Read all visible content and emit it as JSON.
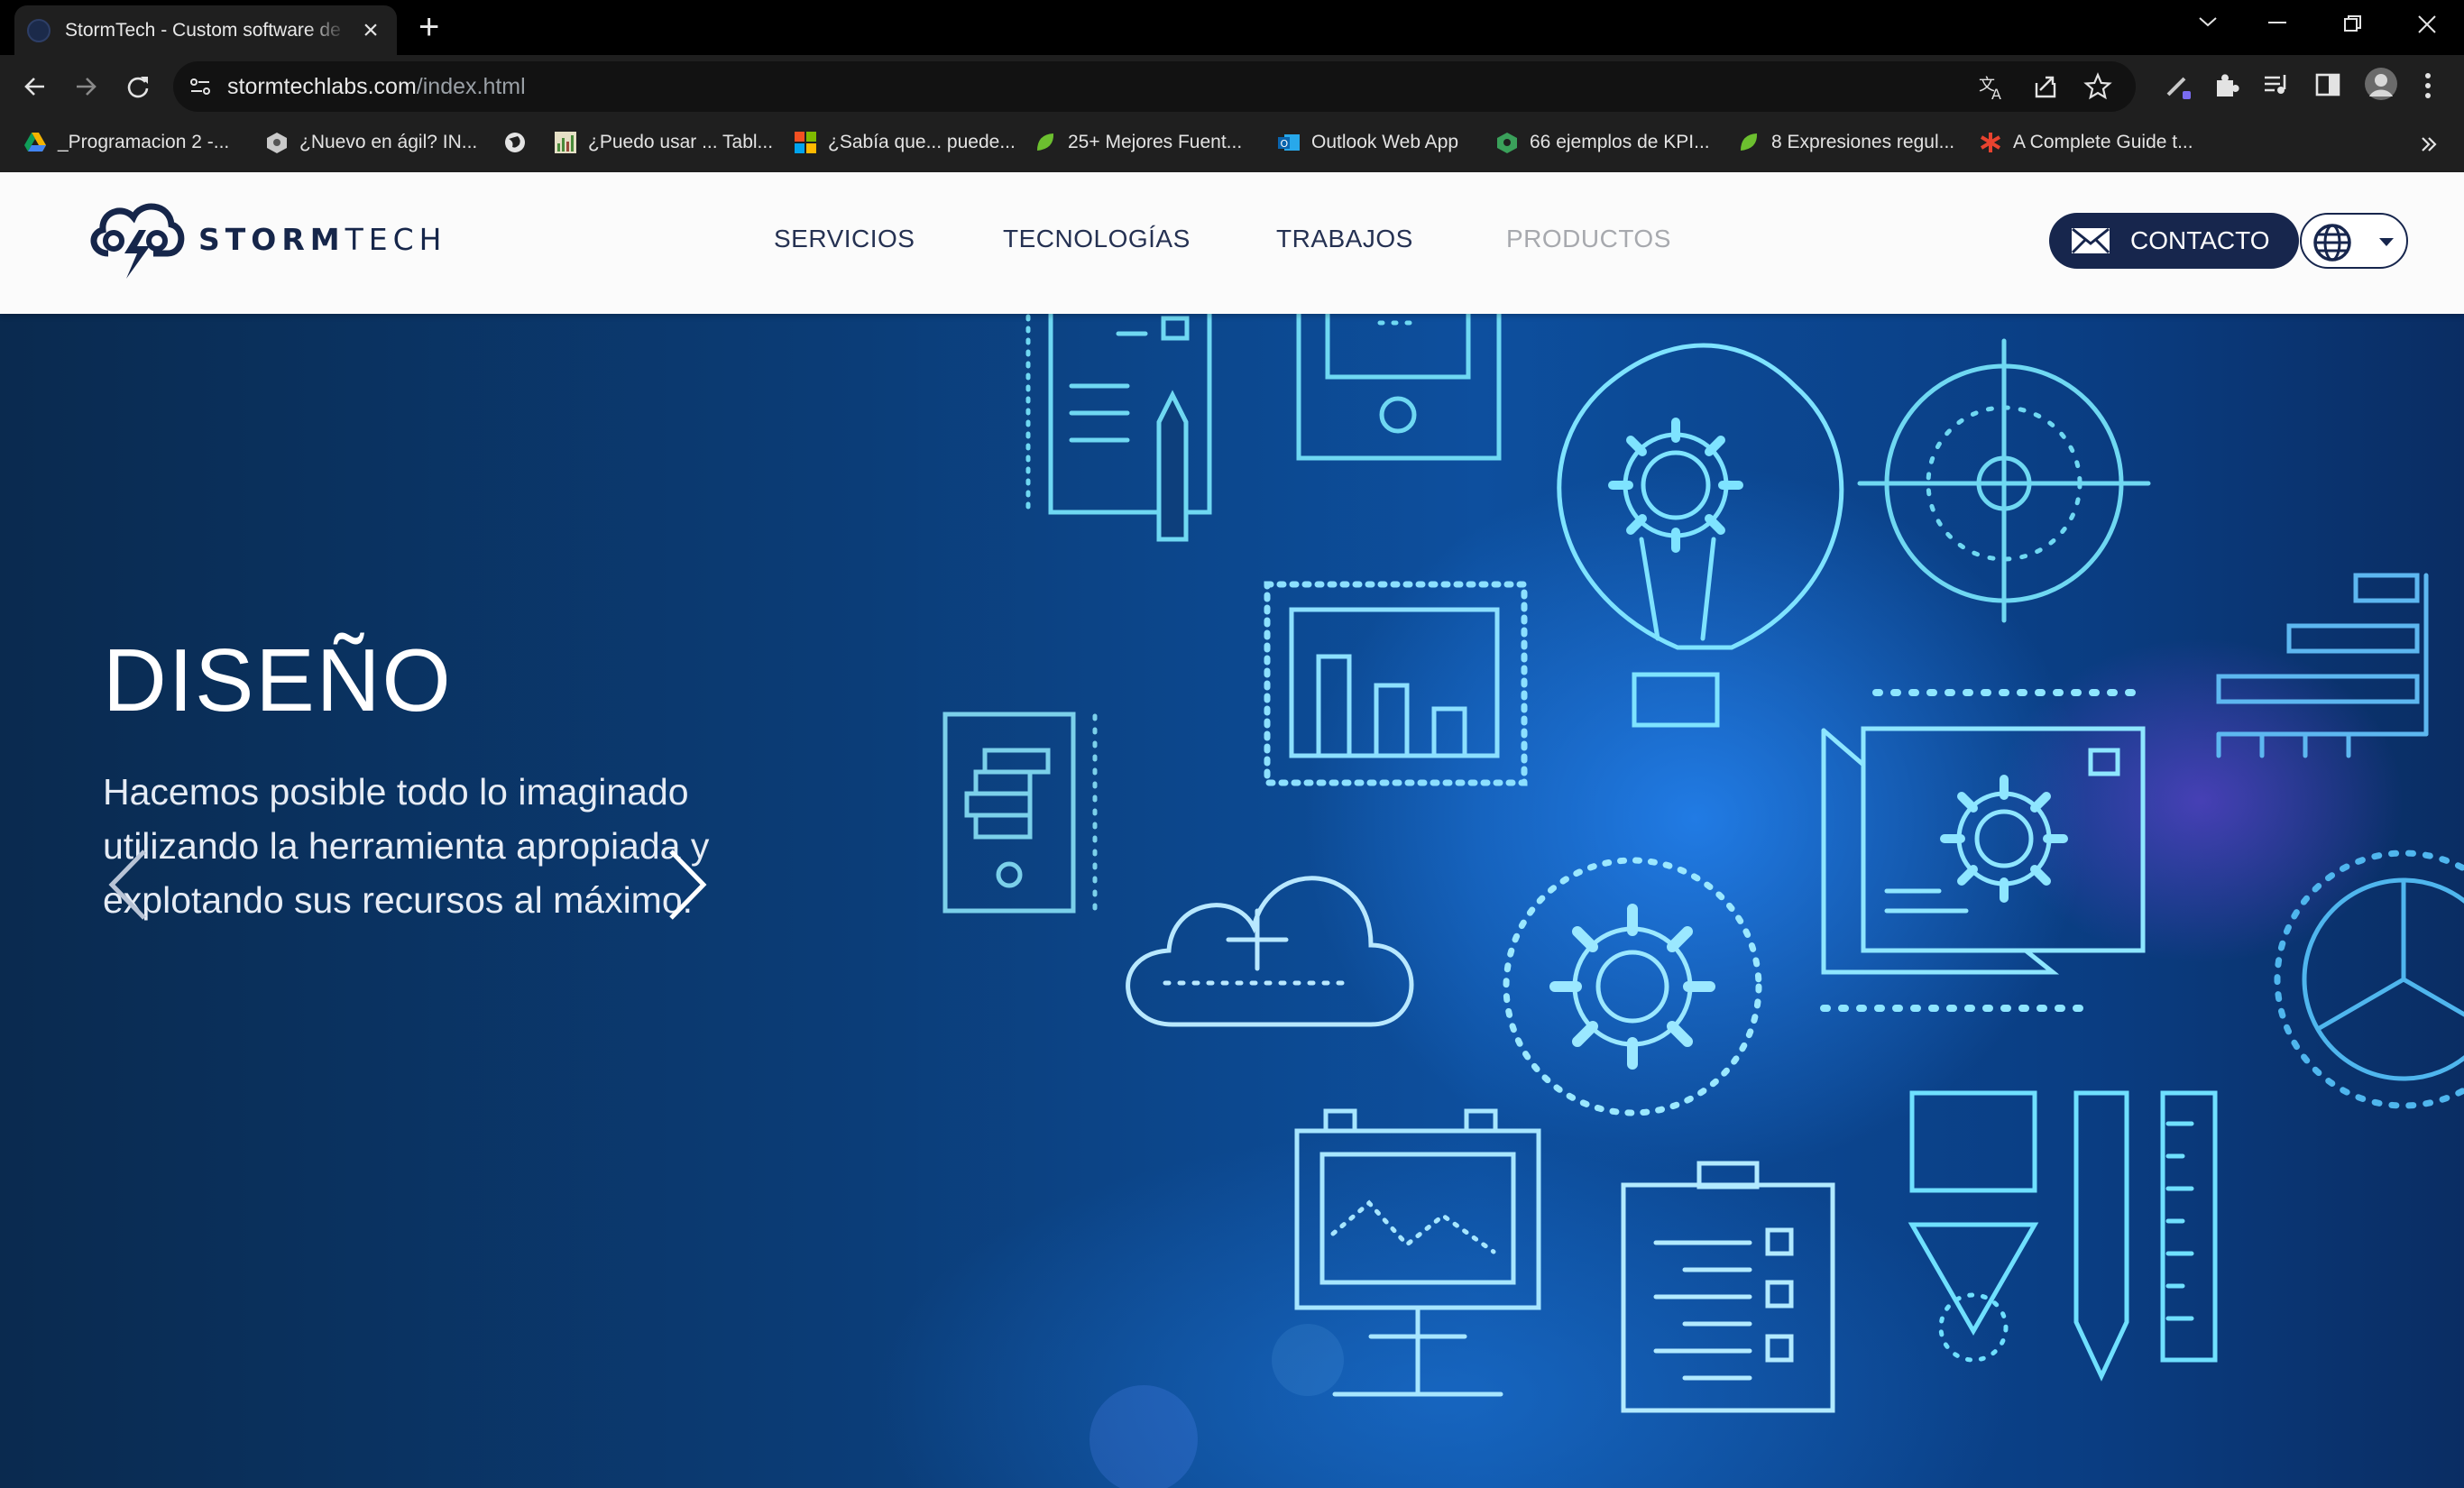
{
  "browser": {
    "tab_title": "StormTech - Custom software de",
    "url_host": "stormtechlabs.com",
    "url_path": "/index.html"
  },
  "bookmarks": [
    {
      "label": "_Programacion 2 -...",
      "icon": "drive-icon"
    },
    {
      "label": "¿Nuevo en ágil? IN...",
      "icon": "site-icon"
    },
    {
      "label": "",
      "icon": "globe-icon"
    },
    {
      "label": "¿Puedo usar ... Tabl...",
      "icon": "site-icon"
    },
    {
      "label": "¿Sabía que... puede...",
      "icon": "microsoft-icon"
    },
    {
      "label": "25+ Mejores Fuent...",
      "icon": "leaf-icon"
    },
    {
      "label": "Outlook Web App",
      "icon": "outlook-icon"
    },
    {
      "label": "66 ejemplos de KPI...",
      "icon": "site-icon"
    },
    {
      "label": "8 Expresiones regul...",
      "icon": "leaf-icon"
    },
    {
      "label": "A Complete Guide t...",
      "icon": "asterisk-icon"
    }
  ],
  "site": {
    "logo_bold": "STORM",
    "logo_light": "TECH",
    "nav": [
      "SERVICIOS",
      "TECNOLOGÍAS",
      "TRABAJOS",
      "PRODUCTOS"
    ],
    "contact_label": "CONTACTO"
  },
  "hero": {
    "title": "DISEÑO",
    "text": "Hacemos posible todo lo imaginado utilizando la herramienta apropiada y explotando sus recursos al máximo."
  },
  "colors": {
    "brand_navy": "#17264d",
    "hero_blue": "#0d4f9e",
    "icon_cyan": "#6fd8f2"
  }
}
